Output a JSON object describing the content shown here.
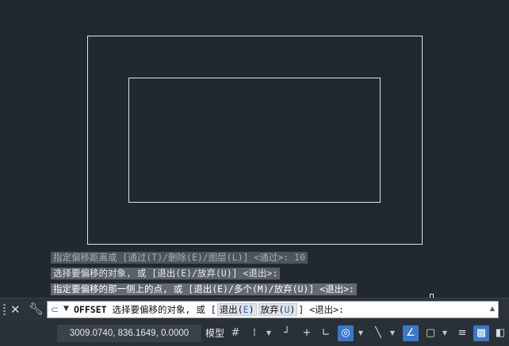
{
  "history": {
    "line1": "指定偏移距离或 [通过(T)/删除(E)/图层(L)] <通过>:  10",
    "line2": "选择要偏移的对象, 或 [退出(E)/放弃(U)] <退出>:",
    "line3": "指定要偏移的那一侧上的点, 或 [退出(E)/多个(M)/放弃(U)] <退出>:"
  },
  "command": {
    "name": "OFFSET",
    "prompt": "选择要偏移的对象, 或 [",
    "opt_exit_label": "退出(",
    "opt_exit_key": "E",
    "opt_undo_label": "放弃(",
    "opt_undo_key": "U",
    "close_paren": ")",
    "suffix": "] <退出>:"
  },
  "status": {
    "coordinates": "3009.0740, 836.1649, 0.0000",
    "model_label": "模型"
  },
  "icons": {
    "close": "close-icon",
    "customize": "wrench-icon",
    "command": "command-icon",
    "grid": "grid-icon",
    "snap": "snap-icon",
    "infer": "infer-constraints-icon",
    "dynamic_input": "dynamic-input-icon",
    "ortho": "ortho-icon",
    "polar": "polar-tracking-icon",
    "isodraft": "isodraft-icon",
    "osnap_tracking": "object-snap-tracking-icon",
    "osnap": "object-snap-icon",
    "lineweight": "lineweight-icon",
    "transparency": "transparency-icon"
  },
  "colors": {
    "canvas": "#212830",
    "accent": "#3a78c8",
    "geometry": "#dfe3e8"
  }
}
